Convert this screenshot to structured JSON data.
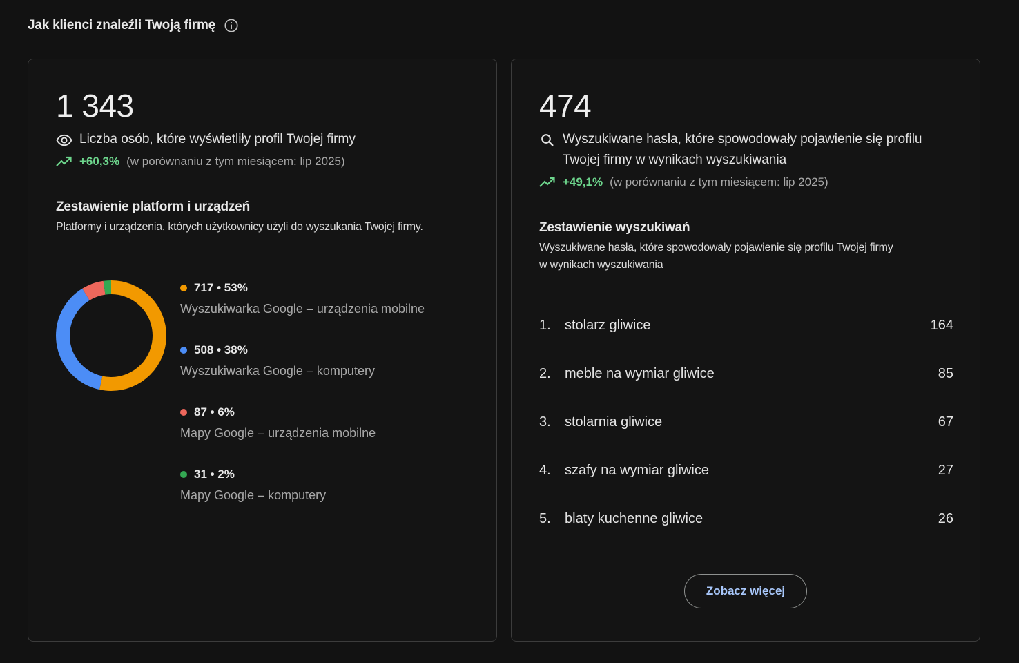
{
  "header": {
    "title": "Jak klienci znaleźli Twoją firmę",
    "info_icon": "info-icon"
  },
  "views_card": {
    "total": "1 343",
    "metric_icon": "eye-icon",
    "metric_label": "Liczba osób, które wyświetliły profil Twojej firmy",
    "trend_icon": "trending-up-icon",
    "trend_value": "+60,3%",
    "trend_compare": "(w porównaniu z tym miesiącem: lip 2025)",
    "section_title": "Zestawienie platform i urządzeń",
    "section_desc": "Platformy i urządzenia, których użytkownicy użyli do wyszukania Twojej firmy.",
    "breakdown": [
      {
        "value": "717",
        "percent": "53%",
        "label": "Wyszukiwarka Google – urządzenia mobilne",
        "color": "#f29900",
        "count": 717
      },
      {
        "value": "508",
        "percent": "38%",
        "label": "Wyszukiwarka Google – komputery",
        "color": "#4c8df6",
        "count": 508
      },
      {
        "value": "87",
        "percent": "6%",
        "label": "Mapy Google – urządzenia mobilne",
        "color": "#ee675c",
        "count": 87
      },
      {
        "value": "31",
        "percent": "2%",
        "label": "Mapy Google – komputery",
        "color": "#34a853",
        "count": 31
      }
    ]
  },
  "searches_card": {
    "total": "474",
    "metric_icon": "search-icon",
    "metric_label_line1": "Wyszukiwane hasła, które spowodowały pojawienie się profilu",
    "metric_label_line2": "Twojej firmy w wynikach wyszukiwania",
    "trend_icon": "trending-up-icon",
    "trend_value": "+49,1%",
    "trend_compare": "(w porównaniu z tym miesiącem: lip 2025)",
    "section_title": "Zestawienie wyszukiwań",
    "section_desc_line1": "Wyszukiwane hasła, które spowodowały pojawienie się profilu Twojej firmy",
    "section_desc_line2": "w wynikach wyszukiwania",
    "terms": [
      {
        "rank": "1.",
        "term": "stolarz gliwice",
        "count": "164"
      },
      {
        "rank": "2.",
        "term": "meble na wymiar gliwice",
        "count": "85"
      },
      {
        "rank": "3.",
        "term": "stolarnia gliwice",
        "count": "67"
      },
      {
        "rank": "4.",
        "term": "szafy na wymiar gliwice",
        "count": "27"
      },
      {
        "rank": "5.",
        "term": "blaty kuchenne gliwice",
        "count": "26"
      }
    ],
    "more_button": "Zobacz więcej"
  }
}
